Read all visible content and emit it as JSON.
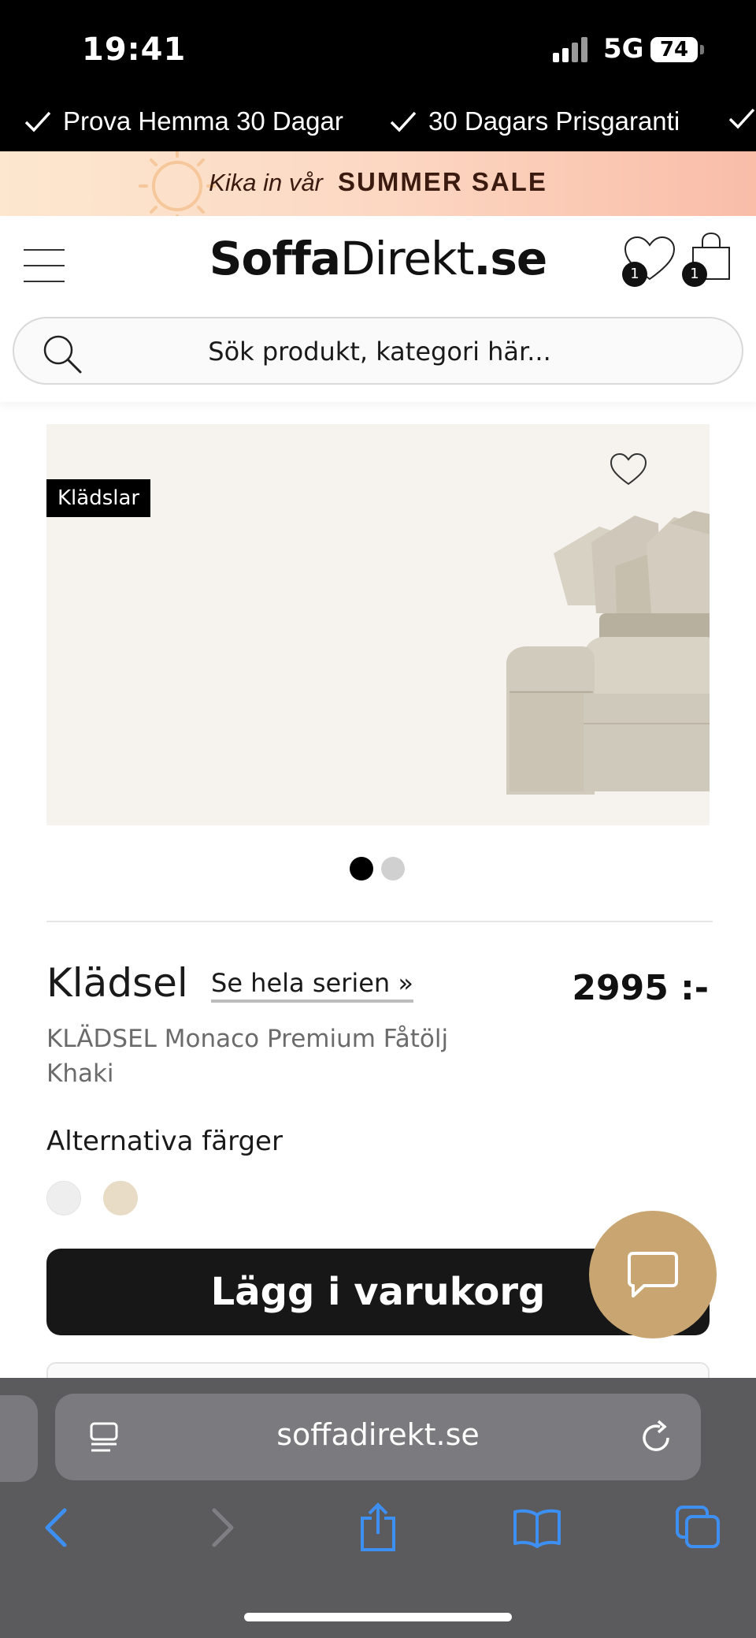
{
  "status_bar": {
    "time": "19:41",
    "network": "5G",
    "battery": "74"
  },
  "usp": {
    "items": [
      "Prova Hemma 30 Dagar",
      "30 Dagars Prisgaranti"
    ]
  },
  "promo": {
    "prefix": "Kika in vår",
    "highlight": "SUMMER SALE"
  },
  "header": {
    "logo_bold": "Soffa",
    "logo_light": "Direkt",
    "logo_suffix": ".se",
    "wishlist_count": "1",
    "cart_count": "1",
    "search_placeholder": "Sök produkt, kategori här..."
  },
  "gallery": {
    "tag": "Klädslar",
    "slides": 2,
    "active_slide": 1
  },
  "product": {
    "brand": "Klädsel",
    "series_link": "Se hela serien »",
    "price": "2995 :-",
    "name_line1": "KLÄDSEL Monaco Premium Fåtölj",
    "name_line2": "Khaki",
    "alt_colors_label": "Alternativa färger",
    "swatches": [
      "#eeeeee",
      "#e8dcc6"
    ],
    "add_to_cart": "Lägg i varukorg"
  },
  "browser": {
    "url": "soffadirekt.se"
  },
  "colors": {
    "accent_gold": "#c9a671",
    "dark": "#171717",
    "ios_blue": "#3d8ff2"
  }
}
